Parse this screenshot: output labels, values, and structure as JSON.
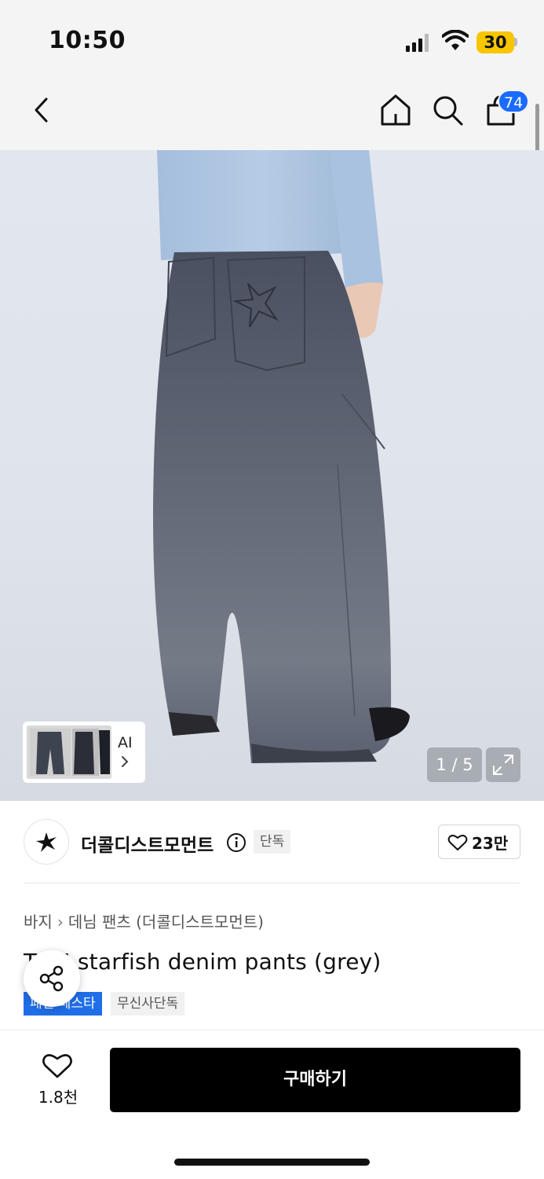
{
  "status_bar": {
    "time": "10:50",
    "battery_level": "30",
    "battery_color": "#f7c600"
  },
  "nav": {
    "back_icon": "chevron-left-icon",
    "home_icon": "home-icon",
    "search_icon": "search-icon",
    "bag_icon": "shopping-bag-icon",
    "bag_count": "74",
    "badge_color": "#1a6bff"
  },
  "gallery": {
    "ai_label": "AI",
    "pager": "1 / 5",
    "expand_icon": "expand-icon"
  },
  "brand": {
    "logo_icon": "starfish-logo-icon",
    "name": "더콜디스트모먼트",
    "exclusive_tag": "단독",
    "like_count": "23만"
  },
  "product": {
    "breadcrumb": [
      "바지",
      "데님 팬츠 (더콜디스트모먼트)"
    ],
    "title": "TCM starfish denim pants (grey)",
    "tags": [
      "패션 페스타",
      "무신사단독"
    ],
    "tag_blue_color": "#1f6ee8"
  },
  "bottom_bar": {
    "wish_count": "1.8천",
    "buy_label": "구매하기"
  }
}
